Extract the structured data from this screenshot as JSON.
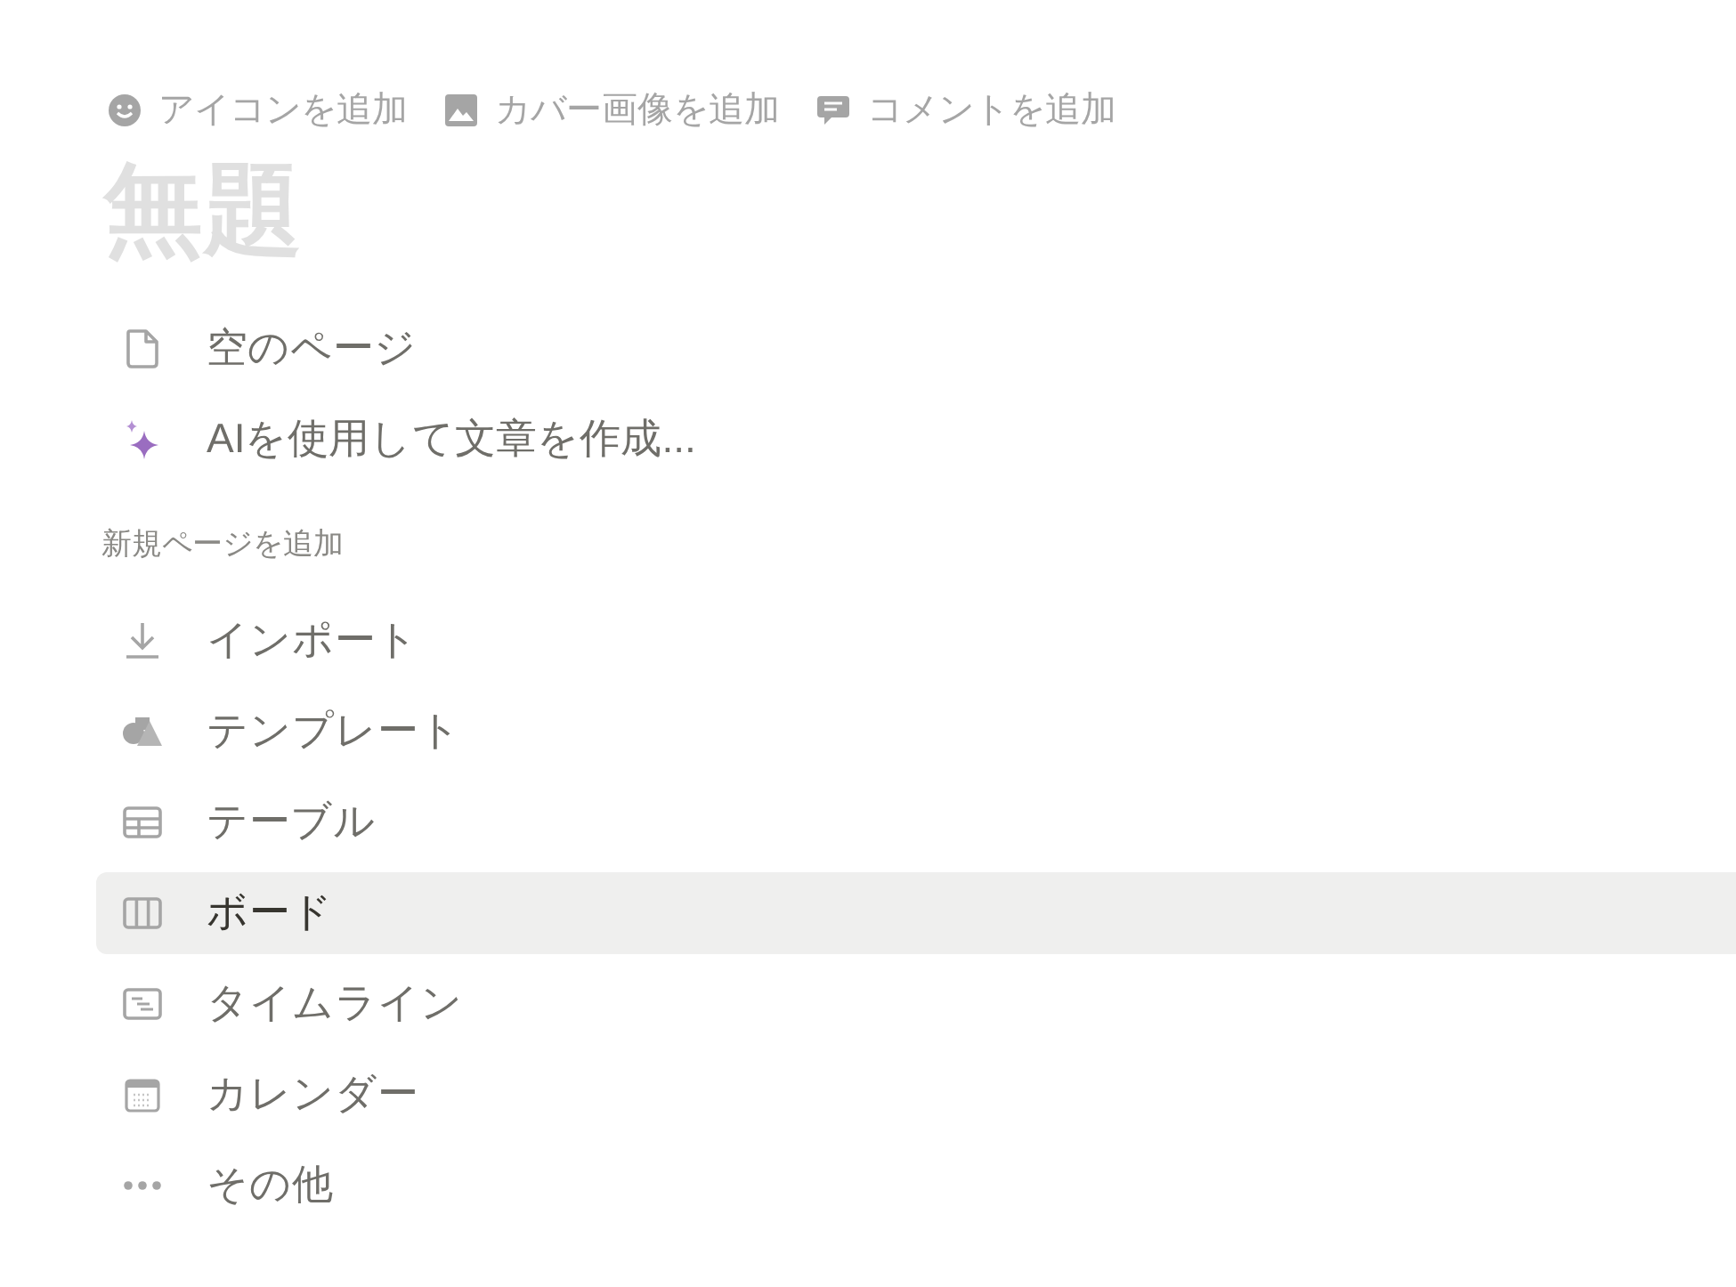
{
  "page_actions": [
    {
      "kind": "icon",
      "label": "アイコンを追加"
    },
    {
      "kind": "cover",
      "label": "カバー画像を追加"
    },
    {
      "kind": "comment",
      "label": "コメントを追加"
    }
  ],
  "title_placeholder": "無題",
  "start_options": [
    {
      "kind": "page",
      "label": "空のページ",
      "selected": false
    },
    {
      "kind": "ai",
      "label": "AIを使用して文章を作成...",
      "selected": false
    }
  ],
  "section_label": "新規ページを追加",
  "add_options": [
    {
      "kind": "import",
      "label": "インポート",
      "selected": false
    },
    {
      "kind": "template",
      "label": "テンプレート",
      "selected": false
    },
    {
      "kind": "table",
      "label": "テーブル",
      "selected": false
    },
    {
      "kind": "board",
      "label": "ボード",
      "selected": true
    },
    {
      "kind": "timeline",
      "label": "タイムライン",
      "selected": false
    },
    {
      "kind": "calendar",
      "label": "カレンダー",
      "selected": false
    },
    {
      "kind": "more",
      "label": "その他",
      "selected": false
    }
  ]
}
